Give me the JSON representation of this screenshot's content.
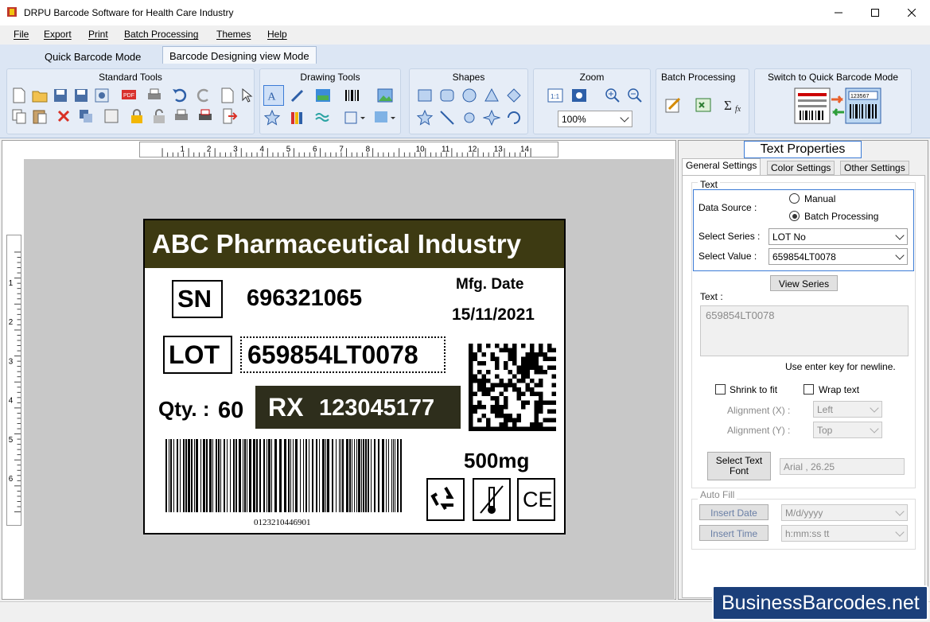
{
  "window": {
    "title": "DRPU Barcode Software for Health Care Industry"
  },
  "menu": [
    "File",
    "Export",
    "Print",
    "Batch Processing",
    "Themes",
    "Help"
  ],
  "tabs": {
    "quick": "Quick Barcode Mode",
    "design": "Barcode Designing view Mode"
  },
  "ribbon": {
    "standard": "Standard Tools",
    "drawing": "Drawing Tools",
    "shapes": "Shapes",
    "zoom": "Zoom",
    "zoom_value": "100%",
    "batch": "Batch Processing",
    "switch": "Switch to Quick Barcode Mode",
    "switch_barcode_num": "123567"
  },
  "ruler": {
    "h": [
      "1",
      "2",
      "3",
      "4",
      "5",
      "6",
      "7",
      "8",
      "10",
      "11",
      "12",
      "13",
      "14"
    ],
    "v": [
      "1",
      "2",
      "3",
      "4",
      "5",
      "6"
    ]
  },
  "label": {
    "company": "ABC Pharmaceutical Industry",
    "sn_tag": "SN",
    "sn_value": "696321065",
    "mfg_label": "Mfg. Date",
    "mfg_value": "15/11/2021",
    "lot_tag": "LOT",
    "lot_value": "659854LT0078",
    "qty_label": "Qty. :",
    "qty_value": "60",
    "rx_tag": "RX",
    "rx_value": "123045177",
    "dose": "500mg",
    "barcode_text": "0123210446901",
    "ce_mark": "CE"
  },
  "panel": {
    "title": "Text Properties",
    "tabs": [
      "General Settings",
      "Color Settings",
      "Other Settings"
    ],
    "text_group": "Text",
    "data_source_label": "Data Source :",
    "manual": "Manual",
    "batch": "Batch Processing",
    "select_series_label": "Select Series :",
    "series_value": "LOT No",
    "select_value_label": "Select Value :",
    "value_value": "659854LT0078",
    "view_series": "View Series",
    "text_label": "Text :",
    "text_value": "659854LT0078",
    "hint": "Use enter key for newline.",
    "shrink": "Shrink to fit",
    "wrap": "Wrap text",
    "align_x_label": "Alignment (X) :",
    "align_x": "Left",
    "align_y_label": "Alignment (Y) :",
    "align_y": "Top",
    "font_btn_l1": "Select Text",
    "font_btn_l2": "Font",
    "font_value": "Arial , 26.25",
    "autofill": "Auto Fill",
    "insert_date": "Insert Date",
    "date_fmt": "M/d/yyyy",
    "insert_time": "Insert Time",
    "time_fmt": "h:mm:ss tt"
  },
  "brand": "BusinessBarcodes.net",
  "colors": {
    "label_header": "#3d3a12",
    "rx_bg": "#2e2e1c",
    "brand_bg": "#1b3f7a"
  }
}
